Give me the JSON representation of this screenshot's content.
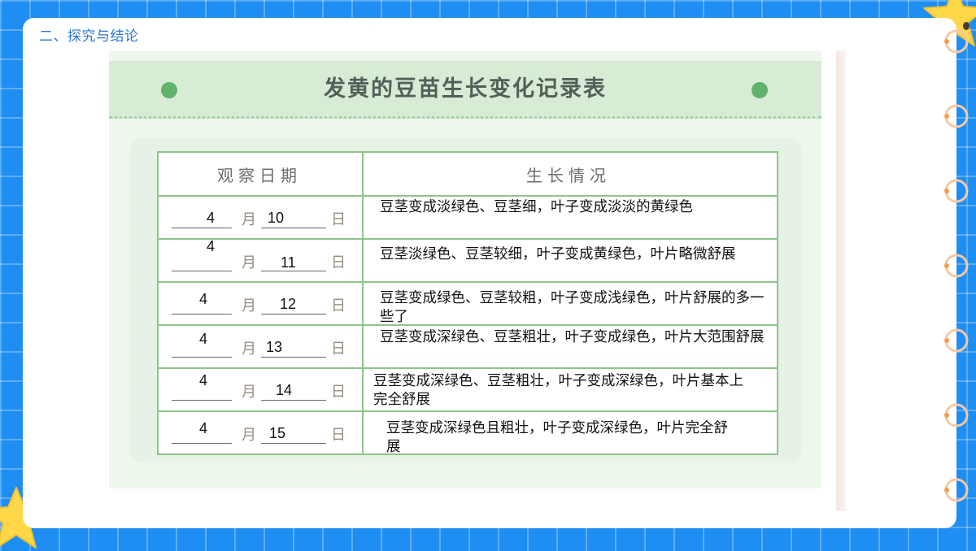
{
  "section_title": "二、探究与结论",
  "table": {
    "title": "发黄的豆苗生长变化记录表",
    "headers": {
      "date": "观察日期",
      "growth": "生长情况"
    },
    "month_unit": "月",
    "day_unit": "日",
    "rows": [
      {
        "month": "4",
        "day": "10",
        "growth": "豆茎变成淡绿色、豆茎细，叶子变成淡淡的黄绿色"
      },
      {
        "month": "4",
        "day": "11",
        "growth": "豆茎淡绿色、豆茎较细，叶子变成黄绿色，叶片略微舒展"
      },
      {
        "month": "4",
        "day": "12",
        "growth": "豆茎变成绿色、豆茎较粗，叶子变成浅绿色，叶片舒展的多一些了"
      },
      {
        "month": "4",
        "day": "13",
        "growth": "豆茎变成深绿色、豆茎粗壮，叶子变成绿色，叶片大范围舒展"
      },
      {
        "month": "4",
        "day": "14",
        "growth": "豆茎变成深绿色、豆茎粗壮，叶子变成深绿色，叶片基本上完全舒展"
      },
      {
        "month": "4",
        "day": "15",
        "growth": "豆茎变成深绿色且粗壮，叶子变成深绿色，叶片完全舒展"
      }
    ]
  },
  "colors": {
    "background": "#1e8ef3",
    "table_border": "#8cc58a",
    "header_band": "#d7ebd5",
    "title_text": "#2a79d6"
  }
}
